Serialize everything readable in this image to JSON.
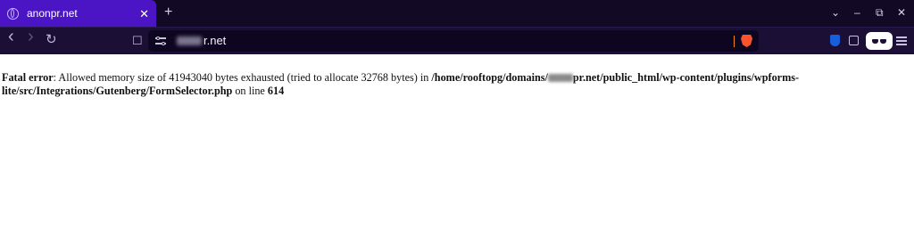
{
  "tab": {
    "title": "anonpr.net",
    "close": "✕",
    "new_tab": "+"
  },
  "window_controls": {
    "dropdown": "⌄",
    "minimize": "–",
    "restore": "⧉",
    "close": "✕"
  },
  "nav": {
    "back": "‹",
    "forward": "›",
    "reload": "↻",
    "bookmark": "☐"
  },
  "address": {
    "url_suffix": "r.net"
  },
  "error": {
    "label": "Fatal error",
    "message": ": Allowed memory size of 41943040 bytes exhausted (tried to allocate 32768 bytes) in ",
    "path_start": "/home/rooftopg/domains/",
    "path_end_line1": "pr.net/public_html/wp-content/plugins/wpforms-",
    "path_line2": "lite/src/Integrations/Gutenberg/FormSelector.php",
    "on_line": " on line ",
    "line_number": "614"
  },
  "colors": {
    "tab_active": "#4b14c4",
    "tabbar_bg": "#120a24",
    "toolbar_bg": "#1b0f36",
    "brave": "#fb542b"
  }
}
